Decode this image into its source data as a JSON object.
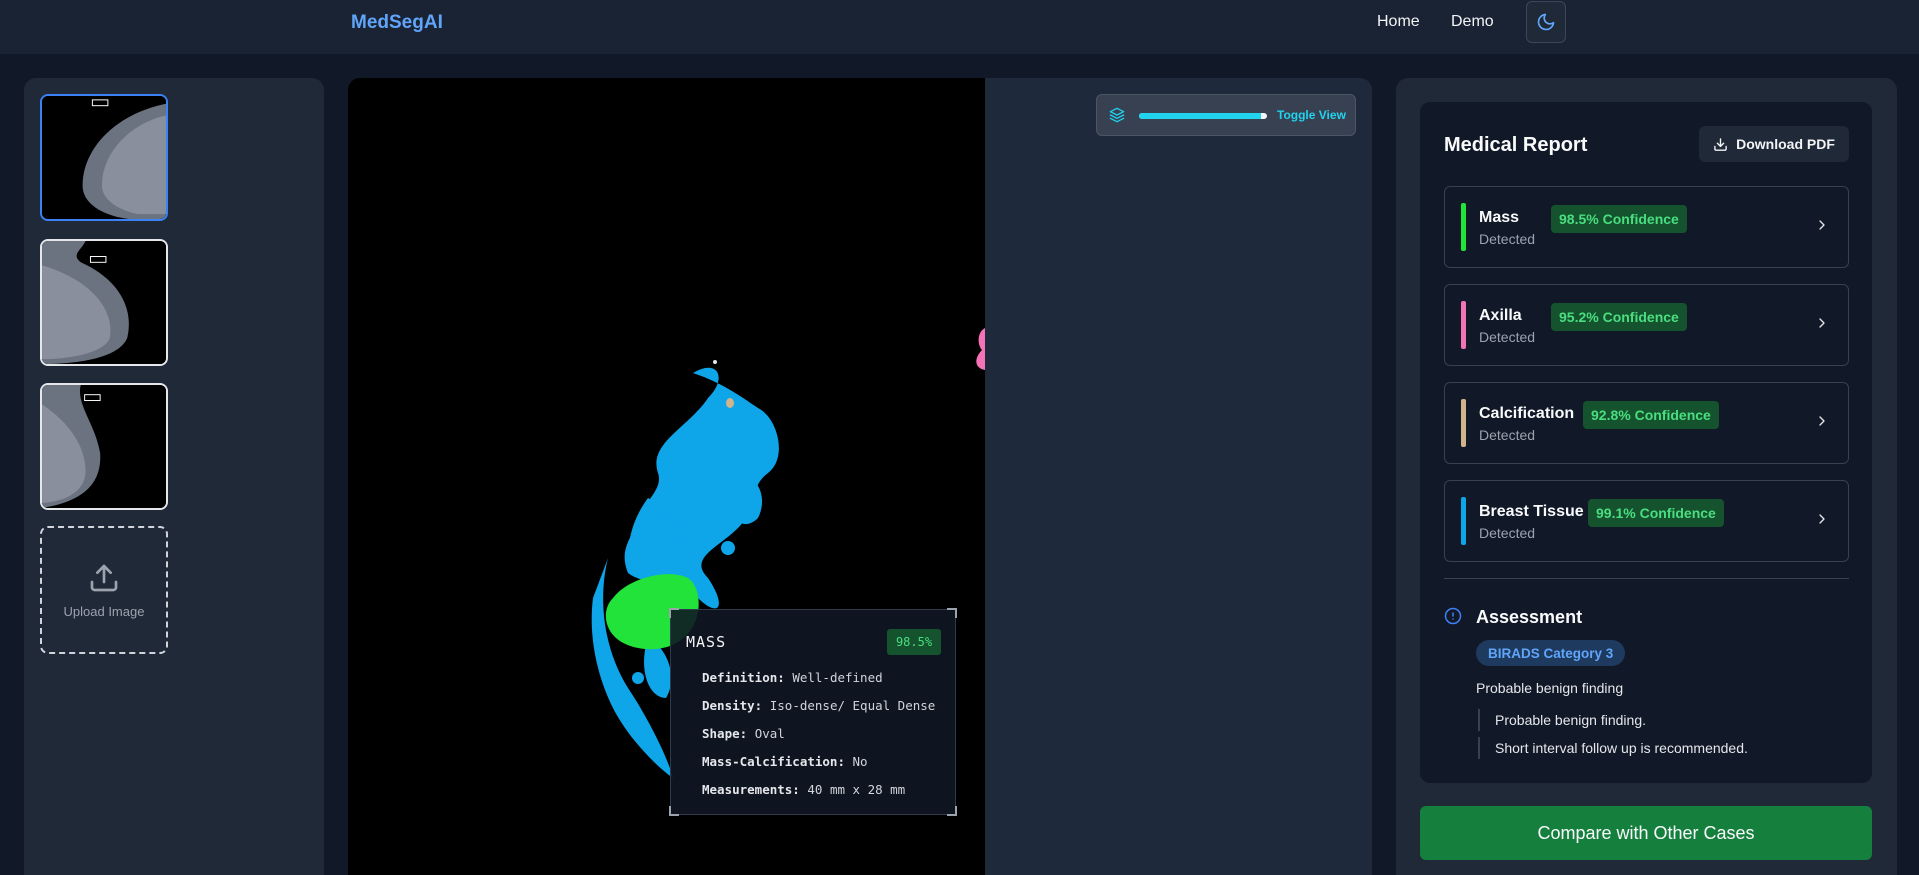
{
  "nav": {
    "brand": "MedSegAI",
    "links": [
      "Home",
      "Demo"
    ],
    "theme_icon": "moon-icon"
  },
  "sidebar": {
    "thumbnails": [
      {
        "name": "mammogram-1",
        "selected": true
      },
      {
        "name": "mammogram-2",
        "selected": false
      },
      {
        "name": "mammogram-3",
        "selected": false
      }
    ],
    "upload_label": "Upload Image"
  },
  "viewer": {
    "toggle_label": "Toggle View",
    "toggle_level": 0.95,
    "mass_card": {
      "title": "MASS",
      "confidence": "98.5%",
      "rows": [
        {
          "label": "Definition:",
          "value": "Well-defined"
        },
        {
          "label": "Density:",
          "value": "Iso-dense/ Equal Dense"
        },
        {
          "label": "Shape:",
          "value": "Oval"
        },
        {
          "label": "Mass-Calcification:",
          "value": "No"
        },
        {
          "label": "Measurements:",
          "value": "40 mm x 28 mm"
        }
      ]
    }
  },
  "report": {
    "title": "Medical Report",
    "download_label": "Download PDF",
    "findings": [
      {
        "name": "Mass",
        "status": "Detected",
        "confidence": "98.5% Confidence",
        "color": "#22e33a"
      },
      {
        "name": "Axilla",
        "status": "Detected",
        "confidence": "95.2% Confidence",
        "color": "#f472b6"
      },
      {
        "name": "Calcification",
        "status": "Detected",
        "confidence": "92.8% Confidence",
        "color": "#d2b48c"
      },
      {
        "name": "Breast Tissue",
        "status": "Detected",
        "confidence": "99.1% Confidence",
        "color": "#0ea5e9"
      }
    ],
    "assessment": {
      "title": "Assessment",
      "birads": "BIRADS Category 3",
      "summary": "Probable benign finding",
      "notes": [
        "Probable benign finding.",
        "Short interval follow up is recommended."
      ]
    },
    "compare_label": "Compare with Other Cases"
  }
}
